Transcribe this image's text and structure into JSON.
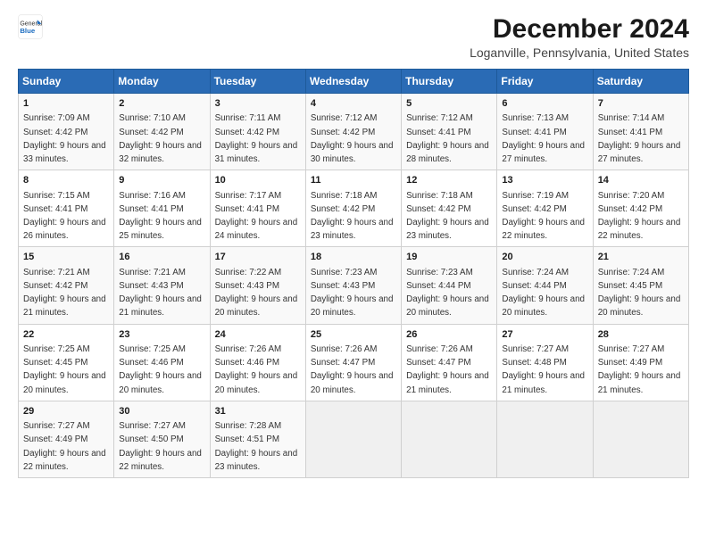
{
  "logo": {
    "general": "General",
    "blue": "Blue"
  },
  "header": {
    "title": "December 2024",
    "subtitle": "Loganville, Pennsylvania, United States"
  },
  "calendar": {
    "columns": [
      "Sunday",
      "Monday",
      "Tuesday",
      "Wednesday",
      "Thursday",
      "Friday",
      "Saturday"
    ],
    "weeks": [
      [
        {
          "day": "1",
          "sunrise": "7:09 AM",
          "sunset": "4:42 PM",
          "daylight": "9 hours and 33 minutes."
        },
        {
          "day": "2",
          "sunrise": "7:10 AM",
          "sunset": "4:42 PM",
          "daylight": "9 hours and 32 minutes."
        },
        {
          "day": "3",
          "sunrise": "7:11 AM",
          "sunset": "4:42 PM",
          "daylight": "9 hours and 31 minutes."
        },
        {
          "day": "4",
          "sunrise": "7:12 AM",
          "sunset": "4:42 PM",
          "daylight": "9 hours and 30 minutes."
        },
        {
          "day": "5",
          "sunrise": "7:12 AM",
          "sunset": "4:41 PM",
          "daylight": "9 hours and 28 minutes."
        },
        {
          "day": "6",
          "sunrise": "7:13 AM",
          "sunset": "4:41 PM",
          "daylight": "9 hours and 27 minutes."
        },
        {
          "day": "7",
          "sunrise": "7:14 AM",
          "sunset": "4:41 PM",
          "daylight": "9 hours and 27 minutes."
        }
      ],
      [
        {
          "day": "8",
          "sunrise": "7:15 AM",
          "sunset": "4:41 PM",
          "daylight": "9 hours and 26 minutes."
        },
        {
          "day": "9",
          "sunrise": "7:16 AM",
          "sunset": "4:41 PM",
          "daylight": "9 hours and 25 minutes."
        },
        {
          "day": "10",
          "sunrise": "7:17 AM",
          "sunset": "4:41 PM",
          "daylight": "9 hours and 24 minutes."
        },
        {
          "day": "11",
          "sunrise": "7:18 AM",
          "sunset": "4:42 PM",
          "daylight": "9 hours and 23 minutes."
        },
        {
          "day": "12",
          "sunrise": "7:18 AM",
          "sunset": "4:42 PM",
          "daylight": "9 hours and 23 minutes."
        },
        {
          "day": "13",
          "sunrise": "7:19 AM",
          "sunset": "4:42 PM",
          "daylight": "9 hours and 22 minutes."
        },
        {
          "day": "14",
          "sunrise": "7:20 AM",
          "sunset": "4:42 PM",
          "daylight": "9 hours and 22 minutes."
        }
      ],
      [
        {
          "day": "15",
          "sunrise": "7:21 AM",
          "sunset": "4:42 PM",
          "daylight": "9 hours and 21 minutes."
        },
        {
          "day": "16",
          "sunrise": "7:21 AM",
          "sunset": "4:43 PM",
          "daylight": "9 hours and 21 minutes."
        },
        {
          "day": "17",
          "sunrise": "7:22 AM",
          "sunset": "4:43 PM",
          "daylight": "9 hours and 20 minutes."
        },
        {
          "day": "18",
          "sunrise": "7:23 AM",
          "sunset": "4:43 PM",
          "daylight": "9 hours and 20 minutes."
        },
        {
          "day": "19",
          "sunrise": "7:23 AM",
          "sunset": "4:44 PM",
          "daylight": "9 hours and 20 minutes."
        },
        {
          "day": "20",
          "sunrise": "7:24 AM",
          "sunset": "4:44 PM",
          "daylight": "9 hours and 20 minutes."
        },
        {
          "day": "21",
          "sunrise": "7:24 AM",
          "sunset": "4:45 PM",
          "daylight": "9 hours and 20 minutes."
        }
      ],
      [
        {
          "day": "22",
          "sunrise": "7:25 AM",
          "sunset": "4:45 PM",
          "daylight": "9 hours and 20 minutes."
        },
        {
          "day": "23",
          "sunrise": "7:25 AM",
          "sunset": "4:46 PM",
          "daylight": "9 hours and 20 minutes."
        },
        {
          "day": "24",
          "sunrise": "7:26 AM",
          "sunset": "4:46 PM",
          "daylight": "9 hours and 20 minutes."
        },
        {
          "day": "25",
          "sunrise": "7:26 AM",
          "sunset": "4:47 PM",
          "daylight": "9 hours and 20 minutes."
        },
        {
          "day": "26",
          "sunrise": "7:26 AM",
          "sunset": "4:47 PM",
          "daylight": "9 hours and 21 minutes."
        },
        {
          "day": "27",
          "sunrise": "7:27 AM",
          "sunset": "4:48 PM",
          "daylight": "9 hours and 21 minutes."
        },
        {
          "day": "28",
          "sunrise": "7:27 AM",
          "sunset": "4:49 PM",
          "daylight": "9 hours and 21 minutes."
        }
      ],
      [
        {
          "day": "29",
          "sunrise": "7:27 AM",
          "sunset": "4:49 PM",
          "daylight": "9 hours and 22 minutes."
        },
        {
          "day": "30",
          "sunrise": "7:27 AM",
          "sunset": "4:50 PM",
          "daylight": "9 hours and 22 minutes."
        },
        {
          "day": "31",
          "sunrise": "7:28 AM",
          "sunset": "4:51 PM",
          "daylight": "9 hours and 23 minutes."
        },
        null,
        null,
        null,
        null
      ]
    ]
  }
}
